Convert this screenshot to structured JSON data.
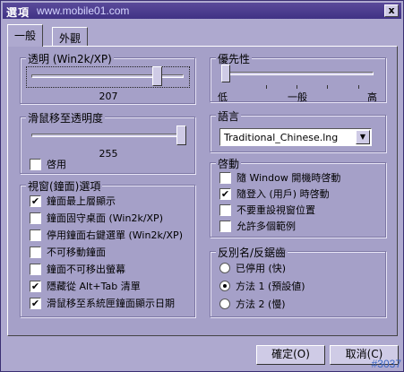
{
  "window": {
    "title": "選項",
    "site": "www.mobile01.com",
    "close_glyph": "x",
    "watermark": "#3037"
  },
  "tabs": [
    {
      "label": "一般",
      "active": true
    },
    {
      "label": "外觀",
      "active": false
    }
  ],
  "transparency": {
    "legend": "透明 (Win2k/XP)",
    "value": "207"
  },
  "hover_transparency": {
    "legend": "滑鼠移至透明度",
    "value": "255",
    "enable_label": "啓用",
    "enable_checked": false
  },
  "clock_options": {
    "legend": "視窗(鐘面)選項",
    "items": [
      {
        "label": "鐘面最上層顯示",
        "checked": true
      },
      {
        "label": "鐘面固守桌面 (Win2k/XP)",
        "checked": false
      },
      {
        "label": "停用鐘面右鍵選單 (Win2k/XP)",
        "checked": false
      },
      {
        "label": "不可移動鐘面",
        "checked": false
      },
      {
        "label": "鐘面不可移出螢幕",
        "checked": false
      },
      {
        "label": "隱藏從 Alt+Tab 清單",
        "checked": true
      },
      {
        "label": "滑鼠移至系統匣鐘面顯示日期",
        "checked": true
      }
    ]
  },
  "priority": {
    "legend": "優先性",
    "low": "低",
    "normal": "一般",
    "high": "高"
  },
  "language": {
    "legend": "語言",
    "selected": "Traditional_Chinese.lng",
    "arrow": "▼"
  },
  "startup": {
    "legend": "啓動",
    "items": [
      {
        "label": "隨 Window 開機時啓動",
        "checked": false
      },
      {
        "label": "隨登入 (用戶) 時啓動",
        "checked": true
      },
      {
        "label": "不要重設視窗位置",
        "checked": false
      },
      {
        "label": "允許多個範例",
        "checked": false
      }
    ]
  },
  "antialias": {
    "legend": "反別名/反鋸齒",
    "items": [
      {
        "label": "已停用 (快)",
        "selected": false
      },
      {
        "label": "方法 1 (預設値)",
        "selected": true
      },
      {
        "label": "方法 2 (慢)",
        "selected": false
      }
    ]
  },
  "buttons": {
    "ok": "確定(O)",
    "cancel": "取消(C)"
  }
}
